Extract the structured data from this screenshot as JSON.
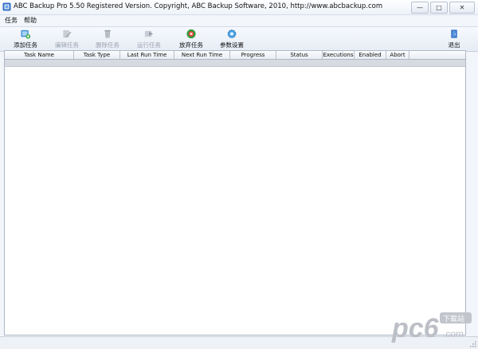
{
  "window": {
    "title": "ABC Backup Pro 5.50   Registered Version.  Copyright,  ABC Backup Software, 2010,   http://www.abcbackup.com",
    "controls": {
      "minimize": "—",
      "maximize": "□",
      "close": "✕"
    }
  },
  "menu": {
    "items": [
      "任务",
      "帮助"
    ]
  },
  "toolbar": {
    "buttons": [
      {
        "label": "添加任务",
        "icon": "add-task-icon",
        "enabled": true
      },
      {
        "label": "编辑任务",
        "icon": "edit-task-icon",
        "enabled": false
      },
      {
        "label": "删除任务",
        "icon": "delete-task-icon",
        "enabled": false
      },
      {
        "label": "运行任务",
        "icon": "run-task-icon",
        "enabled": false
      },
      {
        "label": "放弃任务",
        "icon": "abandon-task-icon",
        "enabled": true
      },
      {
        "label": "参数设置",
        "icon": "settings-icon",
        "enabled": true
      },
      {
        "label": "退出",
        "icon": "exit-icon",
        "enabled": true
      }
    ]
  },
  "table": {
    "columns": [
      "Task Name",
      "Task Type",
      "Last Run Time",
      "Next Run Time",
      "Progress",
      "Status",
      "Executions",
      "Enabled",
      "Abort"
    ],
    "rows": []
  },
  "watermark": {
    "text": "pc6",
    "subtext": "下载站",
    "domain": ".com"
  },
  "colors": {
    "accent": "#2f6fc4",
    "watermark": "#b8bcc3",
    "grid_border": "#aeb8c6"
  }
}
